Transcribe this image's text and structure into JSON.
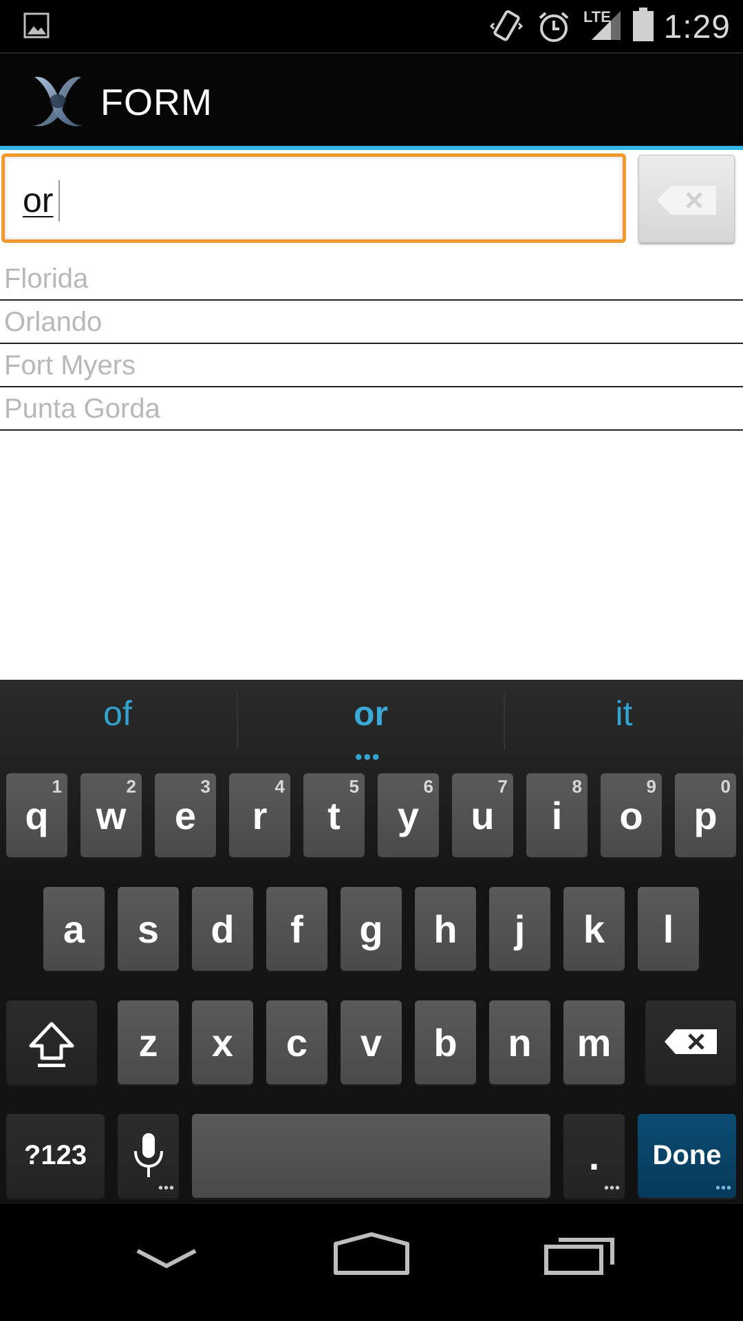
{
  "status_bar": {
    "time": "1:29",
    "network_label": "LTE",
    "icons": [
      "image-icon",
      "vibrate-icon",
      "alarm-icon",
      "signal-icon",
      "battery-icon"
    ]
  },
  "action_bar": {
    "title": "FORM",
    "logo_icon": "app-logo-icon"
  },
  "accent_color": "#33b5e5",
  "search": {
    "value": "or",
    "focus_color": "#f39a2f",
    "clear_icon": "backspace-x-icon"
  },
  "suggestions": [
    "Florida",
    "Orlando",
    "Fort Myers",
    "Punta Gorda"
  ],
  "keyboard": {
    "word_suggestions": [
      "of",
      "or",
      "it"
    ],
    "row1": [
      {
        "key": "q",
        "hint": "1"
      },
      {
        "key": "w",
        "hint": "2"
      },
      {
        "key": "e",
        "hint": "3"
      },
      {
        "key": "r",
        "hint": "4"
      },
      {
        "key": "t",
        "hint": "5"
      },
      {
        "key": "y",
        "hint": "6"
      },
      {
        "key": "u",
        "hint": "7"
      },
      {
        "key": "i",
        "hint": "8"
      },
      {
        "key": "o",
        "hint": "9"
      },
      {
        "key": "p",
        "hint": "0"
      }
    ],
    "row2": [
      "a",
      "s",
      "d",
      "f",
      "g",
      "h",
      "j",
      "k",
      "l"
    ],
    "row3": [
      "z",
      "x",
      "c",
      "v",
      "b",
      "n",
      "m"
    ],
    "symbols_label": "?123",
    "period_label": ".",
    "done_label": "Done",
    "shift_icon": "shift-icon",
    "backspace_icon": "backspace-icon",
    "mic_icon": "microphone-icon"
  },
  "nav_bar": {
    "icons": [
      "back-down-icon",
      "home-icon",
      "recent-apps-icon"
    ]
  }
}
